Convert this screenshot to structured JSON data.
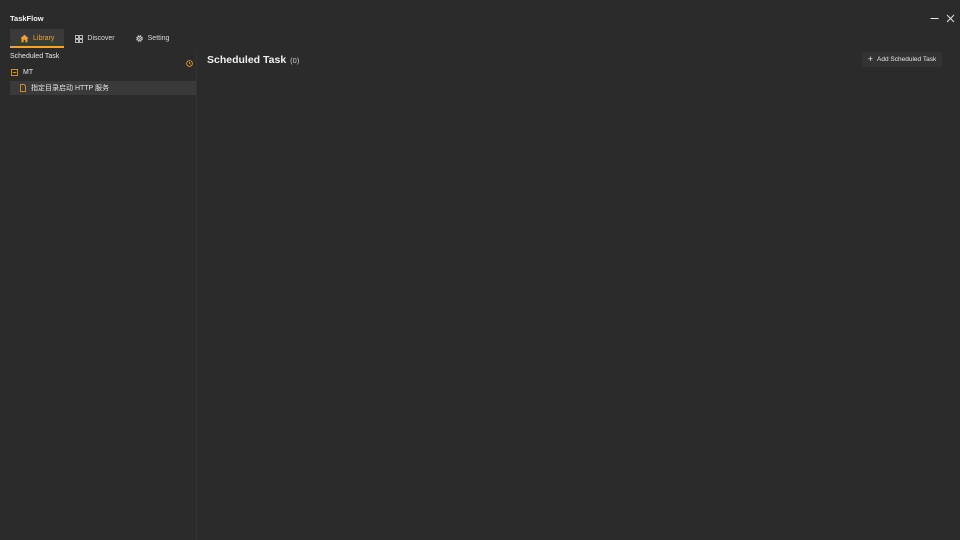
{
  "app": {
    "title": "TaskFlow"
  },
  "colors": {
    "accent": "#f7a12a",
    "background": "#2b2b2b",
    "selected": "#3a3a3a"
  },
  "nav": {
    "tabs": [
      {
        "label": "Library",
        "icon": "home-icon",
        "active": true
      },
      {
        "label": "Discover",
        "icon": "grid-icon",
        "active": false
      },
      {
        "label": "Setting",
        "icon": "gear-icon",
        "active": false
      }
    ]
  },
  "sidebar": {
    "header": "Scheduled Task",
    "header_icon": "clock-icon",
    "groups": [
      {
        "label": "MT",
        "icon": "collapse-icon",
        "items": [
          {
            "label": "指定目录启动 HTTP 服务",
            "icon": "file-icon"
          }
        ]
      }
    ]
  },
  "main": {
    "title": "Scheduled Task",
    "count": "(0)",
    "add_button": {
      "icon": "+",
      "label": "Add Scheduled Task"
    }
  },
  "window_controls": {
    "minimize_icon": "minimize-icon",
    "close_icon": "close-icon"
  }
}
